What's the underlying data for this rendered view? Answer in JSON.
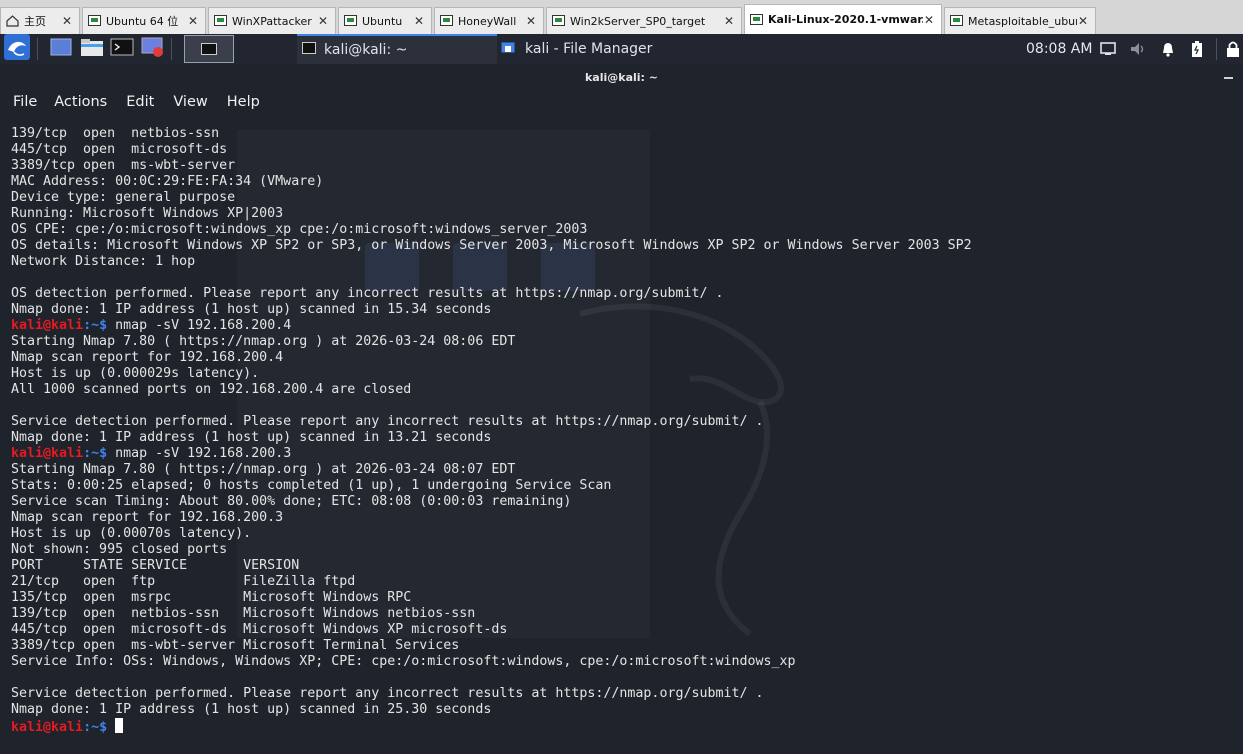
{
  "vm_tabs": [
    {
      "label": "主页",
      "icon": "home-icon",
      "active": false
    },
    {
      "label": "Ubuntu 64 位",
      "icon": "vm-icon",
      "active": false
    },
    {
      "label": "WinXPattacker",
      "icon": "vm-icon",
      "active": false
    },
    {
      "label": "Ubuntu",
      "icon": "vm-icon",
      "active": false
    },
    {
      "label": "HoneyWall",
      "icon": "vm-icon",
      "active": false
    },
    {
      "label": "Win2kServer_SP0_target",
      "icon": "vm-icon",
      "active": false
    },
    {
      "label": "Kali-Linux-2020.1-vmwar...",
      "icon": "vm-icon",
      "active": true
    },
    {
      "label": "Metasploitable_ubuntu",
      "icon": "vm-icon",
      "active": false
    }
  ],
  "panel": {
    "windows": [
      {
        "label": "kali@kali: ~",
        "icon": "terminal-icon"
      },
      {
        "label": "kali - File Manager",
        "icon": "file-manager-icon"
      }
    ],
    "clock": "08:08 AM"
  },
  "terminal": {
    "title": "kali@kali: ~",
    "menu": [
      "File",
      "Actions",
      "Edit",
      "View",
      "Help"
    ],
    "prompt": {
      "user": "kali@kali",
      "sep": ":~$"
    },
    "lines": [
      "139/tcp  open  netbios-ssn",
      "445/tcp  open  microsoft-ds",
      "3389/tcp open  ms-wbt-server",
      "MAC Address: 00:0C:29:FE:FA:34 (VMware)",
      "Device type: general purpose",
      "Running: Microsoft Windows XP|2003",
      "OS CPE: cpe:/o:microsoft:windows_xp cpe:/o:microsoft:windows_server_2003",
      "OS details: Microsoft Windows XP SP2 or SP3, or Windows Server 2003, Microsoft Windows XP SP2 or Windows Server 2003 SP2",
      "Network Distance: 1 hop",
      "",
      "OS detection performed. Please report any incorrect results at https://nmap.org/submit/ .",
      "Nmap done: 1 IP address (1 host up) scanned in 15.34 seconds",
      {
        "prompt": true,
        "cmd": " nmap -sV 192.168.200.4"
      },
      "Starting Nmap 7.80 ( https://nmap.org ) at 2026-03-24 08:06 EDT",
      "Nmap scan report for 192.168.200.4",
      "Host is up (0.000029s latency).",
      "All 1000 scanned ports on 192.168.200.4 are closed",
      "",
      "Service detection performed. Please report any incorrect results at https://nmap.org/submit/ .",
      "Nmap done: 1 IP address (1 host up) scanned in 13.21 seconds",
      {
        "prompt": true,
        "cmd": " nmap -sV 192.168.200.3"
      },
      "Starting Nmap 7.80 ( https://nmap.org ) at 2026-03-24 08:07 EDT",
      "Stats: 0:00:25 elapsed; 0 hosts completed (1 up), 1 undergoing Service Scan",
      "Service scan Timing: About 80.00% done; ETC: 08:08 (0:00:03 remaining)",
      "Nmap scan report for 192.168.200.3",
      "Host is up (0.00070s latency).",
      "Not shown: 995 closed ports",
      "PORT     STATE SERVICE       VERSION",
      "21/tcp   open  ftp           FileZilla ftpd",
      "135/tcp  open  msrpc         Microsoft Windows RPC",
      "139/tcp  open  netbios-ssn   Microsoft Windows netbios-ssn",
      "445/tcp  open  microsoft-ds  Microsoft Windows XP microsoft-ds",
      "3389/tcp open  ms-wbt-server Microsoft Terminal Services",
      "Service Info: OSs: Windows, Windows XP; CPE: cpe:/o:microsoft:windows, cpe:/o:microsoft:windows_xp",
      "",
      "Service detection performed. Please report any incorrect results at https://nmap.org/submit/ .",
      "Nmap done: 1 IP address (1 host up) scanned in 25.30 seconds",
      {
        "prompt": true,
        "cmd": " ",
        "cursor": true
      }
    ]
  },
  "colors": {
    "prompt_user": "#e31b23",
    "prompt_sep": "#3f84e8",
    "terminal_bg": "#1f232b",
    "panel_bg": "#222631"
  }
}
